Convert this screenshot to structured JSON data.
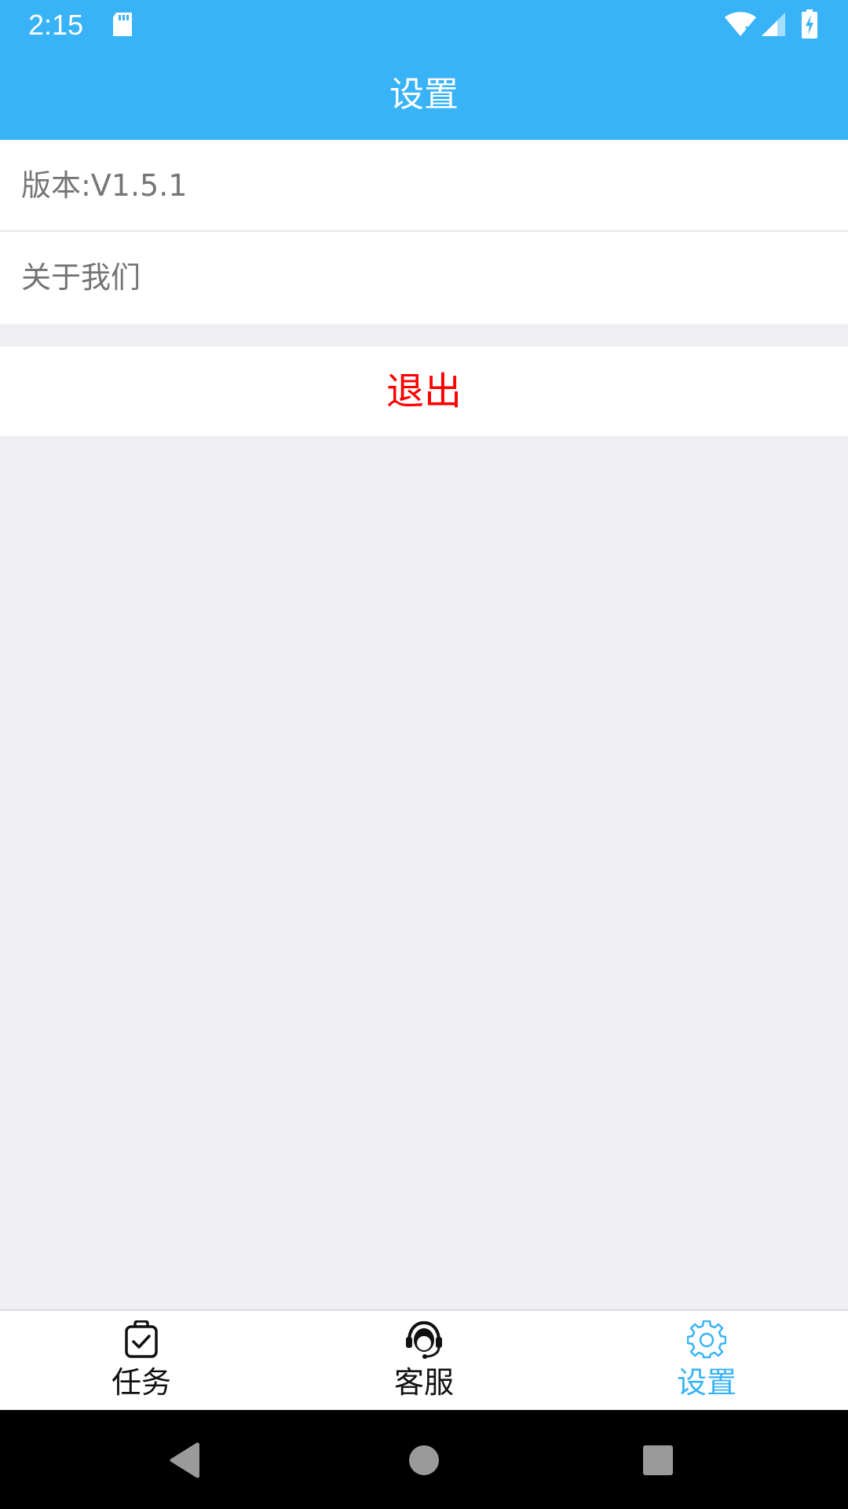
{
  "status_bar": {
    "time": "2:15",
    "icons": [
      "sd-card-icon",
      "wifi-icon",
      "signal-icon",
      "battery-charging-icon"
    ]
  },
  "app_bar": {
    "title": "设置"
  },
  "settings": {
    "version_label": "版本:V1.5.1",
    "about_label": "关于我们",
    "logout_label": "退出"
  },
  "tabs": [
    {
      "label": "任务",
      "icon": "clipboard-check-icon",
      "active": false
    },
    {
      "label": "客服",
      "icon": "headset-agent-icon",
      "active": false
    },
    {
      "label": "设置",
      "icon": "gear-icon",
      "active": true
    }
  ],
  "nav_bar": {
    "buttons": [
      "back-icon",
      "home-icon",
      "recents-icon"
    ]
  },
  "colors": {
    "primary": "#38b3f8",
    "logout": "#ff0000",
    "background": "#eeeef3",
    "secondary_text": "#757575"
  }
}
